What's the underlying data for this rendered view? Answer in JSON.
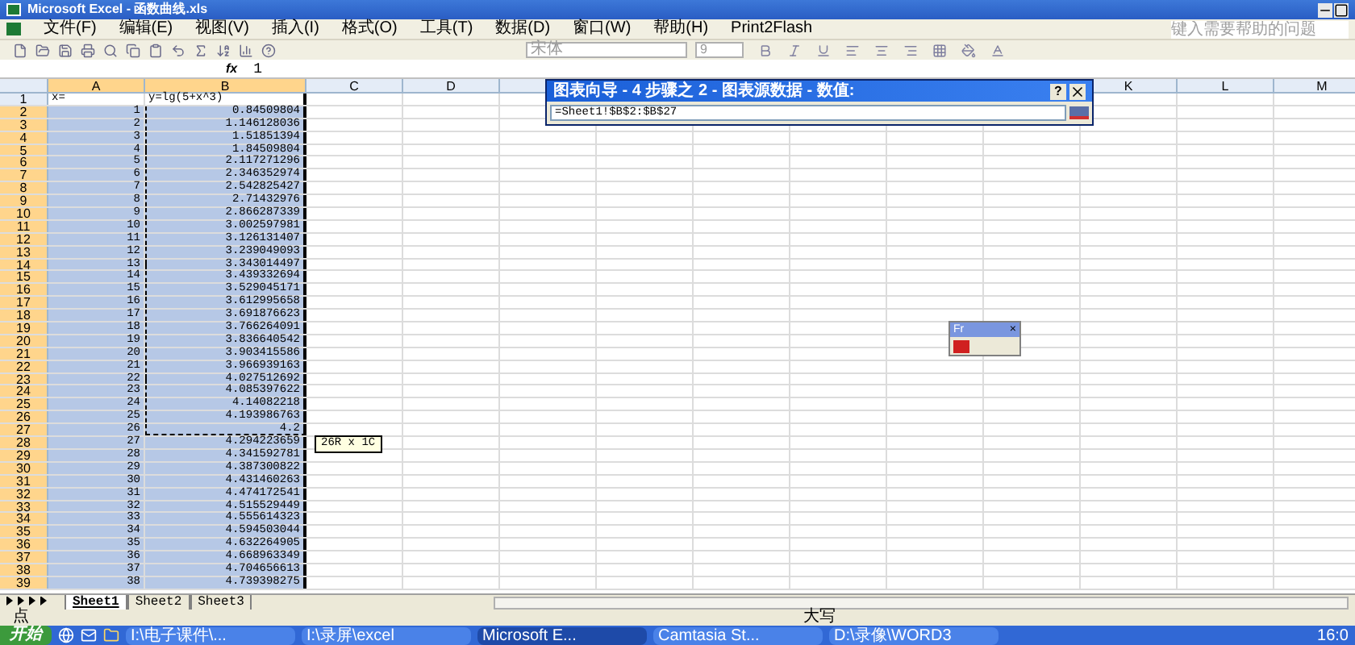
{
  "window": {
    "title": "Microsoft Excel - 函数曲线.xls"
  },
  "menu": [
    "文件(F)",
    "编辑(E)",
    "视图(V)",
    "插入(I)",
    "格式(O)",
    "工具(T)",
    "数据(D)",
    "窗口(W)",
    "帮助(H)",
    "Print2Flash"
  ],
  "help_box": {
    "placeholder": "键入需要帮助的问题"
  },
  "toolbar": {
    "font": "宋体",
    "size": "9"
  },
  "formula_bar": {
    "fx": "fx",
    "value": "1"
  },
  "columns": [
    {
      "label": "A",
      "selected": true
    },
    {
      "label": "B",
      "selected": true
    },
    {
      "label": "C",
      "selected": false
    },
    {
      "label": "D",
      "selected": false
    },
    {
      "label": "K",
      "selected": false
    },
    {
      "label": "L",
      "selected": false
    },
    {
      "label": "M",
      "selected": false
    }
  ],
  "rows": [
    {
      "number": "1",
      "col_a": "x=",
      "col_b": "y=lg(5+x^3)",
      "selected": false,
      "in_range": false
    },
    {
      "number": "2",
      "col_a": "1",
      "col_b": "0.84509804",
      "selected": true,
      "in_range": true
    },
    {
      "number": "3",
      "col_a": "2",
      "col_b": "1.146128036",
      "selected": true,
      "in_range": true
    },
    {
      "number": "4",
      "col_a": "3",
      "col_b": "1.51851394",
      "selected": true,
      "in_range": true
    },
    {
      "number": "5",
      "col_a": "4",
      "col_b": "1.84509804",
      "selected": true,
      "in_range": true
    },
    {
      "number": "6",
      "col_a": "5",
      "col_b": "2.117271296",
      "selected": true,
      "in_range": true
    },
    {
      "number": "7",
      "col_a": "6",
      "col_b": "2.346352974",
      "selected": true,
      "in_range": true
    },
    {
      "number": "8",
      "col_a": "7",
      "col_b": "2.542825427",
      "selected": true,
      "in_range": true
    },
    {
      "number": "9",
      "col_a": "8",
      "col_b": "2.71432976",
      "selected": true,
      "in_range": true
    },
    {
      "number": "10",
      "col_a": "9",
      "col_b": "2.866287339",
      "selected": true,
      "in_range": true
    },
    {
      "number": "11",
      "col_a": "10",
      "col_b": "3.002597981",
      "selected": true,
      "in_range": true
    },
    {
      "number": "12",
      "col_a": "11",
      "col_b": "3.126131407",
      "selected": true,
      "in_range": true
    },
    {
      "number": "13",
      "col_a": "12",
      "col_b": "3.239049093",
      "selected": true,
      "in_range": true
    },
    {
      "number": "14",
      "col_a": "13",
      "col_b": "3.343014497",
      "selected": true,
      "in_range": true
    },
    {
      "number": "15",
      "col_a": "14",
      "col_b": "3.439332694",
      "selected": true,
      "in_range": true
    },
    {
      "number": "16",
      "col_a": "15",
      "col_b": "3.529045171",
      "selected": true,
      "in_range": true
    },
    {
      "number": "17",
      "col_a": "16",
      "col_b": "3.612995658",
      "selected": true,
      "in_range": true
    },
    {
      "number": "18",
      "col_a": "17",
      "col_b": "3.691876623",
      "selected": true,
      "in_range": true
    },
    {
      "number": "19",
      "col_a": "18",
      "col_b": "3.766264091",
      "selected": true,
      "in_range": true
    },
    {
      "number": "20",
      "col_a": "19",
      "col_b": "3.836640542",
      "selected": true,
      "in_range": true
    },
    {
      "number": "21",
      "col_a": "20",
      "col_b": "3.903415586",
      "selected": true,
      "in_range": true
    },
    {
      "number": "22",
      "col_a": "21",
      "col_b": "3.966939163",
      "selected": true,
      "in_range": true
    },
    {
      "number": "23",
      "col_a": "22",
      "col_b": "4.027512692",
      "selected": true,
      "in_range": true
    },
    {
      "number": "24",
      "col_a": "23",
      "col_b": "4.085397622",
      "selected": true,
      "in_range": true
    },
    {
      "number": "25",
      "col_a": "24",
      "col_b": "4.14082218",
      "selected": true,
      "in_range": true
    },
    {
      "number": "26",
      "col_a": "25",
      "col_b": "4.193986763",
      "selected": true,
      "in_range": true
    },
    {
      "number": "27",
      "col_a": "26",
      "col_b": "4.2",
      "selected": true,
      "in_range": true
    },
    {
      "number": "28",
      "col_a": "27",
      "col_b": "4.294223659",
      "selected": true,
      "in_range": false
    },
    {
      "number": "29",
      "col_a": "28",
      "col_b": "4.341592781",
      "selected": true,
      "in_range": false
    },
    {
      "number": "30",
      "col_a": "29",
      "col_b": "4.387300822",
      "selected": true,
      "in_range": false
    },
    {
      "number": "31",
      "col_a": "30",
      "col_b": "4.431460263",
      "selected": true,
      "in_range": false
    },
    {
      "number": "32",
      "col_a": "31",
      "col_b": "4.474172541",
      "selected": true,
      "in_range": false
    },
    {
      "number": "33",
      "col_a": "32",
      "col_b": "4.515529449",
      "selected": true,
      "in_range": false
    },
    {
      "number": "34",
      "col_a": "33",
      "col_b": "4.555614323",
      "selected": true,
      "in_range": false
    },
    {
      "number": "35",
      "col_a": "34",
      "col_b": "4.594503044",
      "selected": true,
      "in_range": false
    },
    {
      "number": "36",
      "col_a": "35",
      "col_b": "4.632264905",
      "selected": true,
      "in_range": false
    },
    {
      "number": "37",
      "col_a": "36",
      "col_b": "4.668963349",
      "selected": true,
      "in_range": false
    },
    {
      "number": "38",
      "col_a": "37",
      "col_b": "4.704656613",
      "selected": true,
      "in_range": false
    },
    {
      "number": "39",
      "col_a": "38",
      "col_b": "4.739398275",
      "selected": true,
      "in_range": false
    }
  ],
  "range_tip": "26R x 1C",
  "dialog": {
    "title": "图表向导 - 4 步骤之 2 - 图表源数据 - 数值:",
    "help": "?",
    "value": "=Sheet1!$B$2:$B$27"
  },
  "mini_toolbar": {
    "title": "Fr",
    "close": "×"
  },
  "sheet_tabs": [
    {
      "label": "Sheet1",
      "selected": true
    },
    {
      "label": "Sheet2",
      "selected": false
    },
    {
      "label": "Sheet3",
      "selected": false
    }
  ],
  "status_bar": {
    "left": "点",
    "right": "大写"
  },
  "taskbar": {
    "start": "开始",
    "items": [
      {
        "label": "I:\\电子课件\\...",
        "selected": false
      },
      {
        "label": "I:\\录屏\\excel",
        "selected": false
      },
      {
        "label": "Microsoft E...",
        "selected": true
      },
      {
        "label": "Camtasia St...",
        "selected": false
      },
      {
        "label": "D:\\录像\\WORD3",
        "selected": false
      }
    ],
    "clock": "16:0"
  }
}
